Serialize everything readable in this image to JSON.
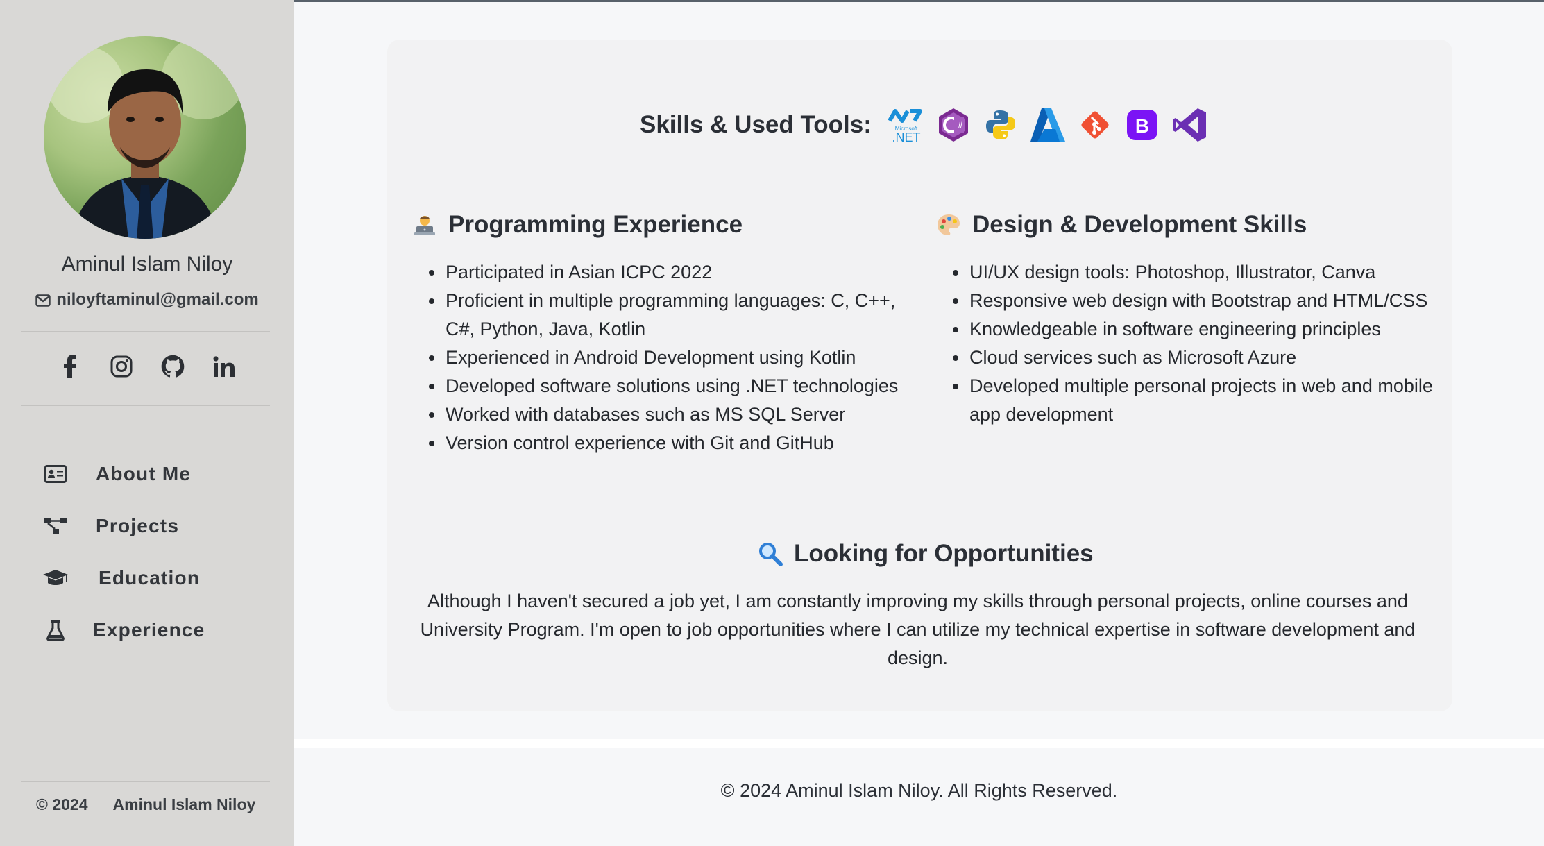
{
  "sidebar": {
    "name": "Aminul Islam Niloy",
    "email": "niloyftaminul@gmail.com",
    "socials": [
      {
        "icon": "facebook-icon"
      },
      {
        "icon": "instagram-icon"
      },
      {
        "icon": "github-icon"
      },
      {
        "icon": "linkedin-icon"
      }
    ],
    "nav": [
      {
        "label": "About Me",
        "icon": "id-card-icon"
      },
      {
        "label": "Projects",
        "icon": "project-diagram-icon"
      },
      {
        "label": "Education",
        "icon": "graduation-cap-icon"
      },
      {
        "label": "Experience",
        "icon": "flask-icon"
      }
    ],
    "footer_year": "© 2024",
    "footer_name": "Aminul Islam Niloy"
  },
  "skills": {
    "title": "Skills & Used Tools:",
    "tools": [
      {
        "icon": "dotnet-icon",
        "color": "#1a8fd8"
      },
      {
        "icon": "csharp-icon",
        "color": "#7b2a91"
      },
      {
        "icon": "python-icon",
        "color": "#3572a5"
      },
      {
        "icon": "azure-icon",
        "color": "#0a78d4"
      },
      {
        "icon": "git-icon",
        "color": "#f05033"
      },
      {
        "icon": "bootstrap-icon",
        "color": "#7b14f5"
      },
      {
        "icon": "visual-studio-icon",
        "color": "#6b2fb3"
      }
    ]
  },
  "programming": {
    "title": "Programming Experience",
    "items": [
      "Participated in Asian ICPC 2022",
      "Proficient in multiple programming languages: C, C++, C#, Python, Java, Kotlin",
      "Experienced in Android Development using Kotlin",
      "Developed software solutions using .NET technologies",
      "Worked with databases such as MS SQL Server",
      "Version control experience with Git and GitHub"
    ]
  },
  "design": {
    "title": "Design & Development Skills",
    "items": [
      "UI/UX design tools: Photoshop, Illustrator, Canva",
      "Responsive web design with Bootstrap and HTML/CSS",
      "Knowledgeable in software engineering principles",
      "Cloud services such as Microsoft Azure",
      "Developed multiple personal projects in web and mobile app development"
    ]
  },
  "opportunities": {
    "title": "Looking for Opportunities",
    "text": "Although I haven't secured a job yet, I am constantly improving my skills through personal projects, online courses and University Program. I'm open to job opportunities where I can utilize my technical expertise in software development and design."
  },
  "footer": {
    "text": "© 2024 Aminul Islam Niloy. All Rights Reserved."
  }
}
